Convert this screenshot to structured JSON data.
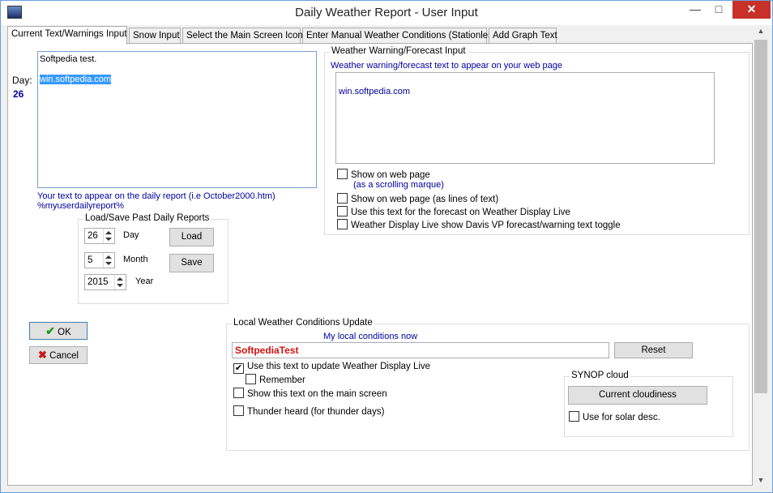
{
  "window": {
    "title": "Daily Weather Report - User Input",
    "controls": {
      "minimize": "—",
      "maximize": "□",
      "close": "✕"
    }
  },
  "tabs": [
    {
      "label": "Current Text/Warnings Input",
      "active": true
    },
    {
      "label": "Snow Input",
      "active": false
    },
    {
      "label": "Select the Main Screen Icon",
      "active": false
    },
    {
      "label": "Enter Manual Weather Conditions (Stationless)",
      "active": false
    },
    {
      "label": "Add Graph Text",
      "active": false
    }
  ],
  "day_panel": {
    "day_label": "Day:",
    "day_value": "26",
    "text_line1": "Softpedia test.",
    "text_line2": "win.softpedia.com",
    "caption_line1": "Your text to appear on the daily report (i.e October2000.htm)",
    "caption_line2": "%myuserdailyreport%"
  },
  "load_save": {
    "title": "Load/Save Past Daily Reports",
    "day": {
      "value": "26",
      "label": "Day"
    },
    "month": {
      "value": "5",
      "label": "Month"
    },
    "year": {
      "value": "2015",
      "label": "Year"
    },
    "load_label": "Load",
    "save_label": "Save"
  },
  "warning": {
    "title": "Weather Warning/Forecast Input",
    "subtitle": "Weather warning/forecast text to appear on your web page",
    "text": "win.softpedia.com",
    "options": {
      "show_web_line1": "Show on web page",
      "show_web_line2": "(as a scrolling marque)",
      "show_lines": "Show on web page (as lines of text)",
      "use_forecast": "Use this text for the forecast on Weather Display Live",
      "davis_toggle": "Weather Display Live show Davis VP forecast/warning text  toggle"
    },
    "checked": {
      "show_web": false,
      "show_lines": false,
      "use_forecast": false,
      "davis_toggle": false
    }
  },
  "actions": {
    "ok_label": "OK",
    "cancel_label": "Cancel"
  },
  "local": {
    "title": "Local Weather Conditions Update",
    "subtitle": "My local conditions now",
    "input_value": "SoftpediaTest",
    "reset_label": "Reset",
    "options": {
      "use_text": "Use this text to update Weather Display Live",
      "remember": "Remember",
      "show_main": "Show this text on the main screen",
      "thunder": "Thunder heard (for thunder days)"
    },
    "checked": {
      "use_text": true,
      "remember": false,
      "show_main": false,
      "thunder": false
    }
  },
  "synop": {
    "title": "SYNOP cloud",
    "button_label": "Current cloudiness",
    "solar_label": "Use for solar desc.",
    "solar_checked": false
  }
}
